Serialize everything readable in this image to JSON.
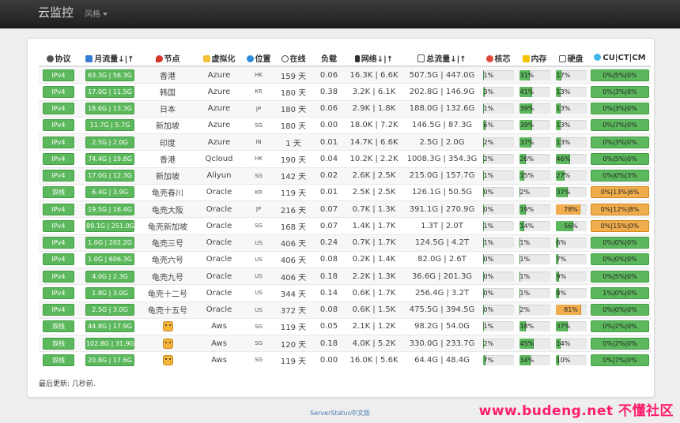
{
  "nav": {
    "brand": "云监控",
    "style_menu": "风格"
  },
  "headers": {
    "protocol": "协议",
    "monthly_traffic": "月流量↓|↑",
    "node": "节点",
    "virtualization": "虚拟化",
    "location": "位置",
    "uptime": "在线",
    "load": "负载",
    "network": "网络↓|↑",
    "total_traffic": "总流量↓|↑",
    "cpu": "核芯",
    "memory": "内存",
    "disk": "硬盘",
    "isp": "CU|CT|CM"
  },
  "rows": [
    {
      "proto": "IPv4",
      "traffic": "63.3G | 56.3G",
      "node": "香港",
      "virt": "Azure",
      "loc": "HK",
      "uptime": "159 天",
      "load": "0.06",
      "net": "16.3K | 6.6K",
      "total": "507.5G | 447.0G",
      "cpu": "1%",
      "cpu_v": 1,
      "mem": "31%",
      "mem_v": 31,
      "disk": "17%",
      "disk_v": 17,
      "isp": "0%|5%|0%",
      "isp_warn": false
    },
    {
      "proto": "IPv4",
      "traffic": "17.0G | 11.5G",
      "node": "韩国",
      "virt": "Azure",
      "loc": "KR",
      "uptime": "180 天",
      "load": "0.38",
      "net": "3.2K | 6.1K",
      "total": "202.8G | 146.9G",
      "cpu": "3%",
      "cpu_v": 3,
      "mem": "41%",
      "mem_v": 41,
      "disk": "13%",
      "disk_v": 13,
      "isp": "0%|3%|0%",
      "isp_warn": false
    },
    {
      "proto": "IPv4",
      "traffic": "18.6G | 13.3G",
      "node": "日本",
      "virt": "Azure",
      "loc": "JP",
      "uptime": "180 天",
      "load": "0.06",
      "net": "2.9K | 1.8K",
      "total": "188.0G | 132.6G",
      "cpu": "1%",
      "cpu_v": 1,
      "mem": "39%",
      "mem_v": 39,
      "disk": "13%",
      "disk_v": 13,
      "isp": "0%|3%|0%",
      "isp_warn": false
    },
    {
      "proto": "IPv4",
      "traffic": "11.7G | 5.7G",
      "node": "新加坡",
      "virt": "Azure",
      "loc": "SG",
      "uptime": "180 天",
      "load": "0.00",
      "net": "18.0K | 7.2K",
      "total": "146.5G | 87.3G",
      "cpu": "6%",
      "cpu_v": 6,
      "mem": "39%",
      "mem_v": 39,
      "disk": "13%",
      "disk_v": 13,
      "isp": "0%|7%|0%",
      "isp_warn": false
    },
    {
      "proto": "IPv4",
      "traffic": "2.5G | 2.0G",
      "node": "印度",
      "virt": "Azure",
      "loc": "IN",
      "uptime": "1 天",
      "load": "0.01",
      "net": "14.7K | 6.6K",
      "total": "2.5G | 2.0G",
      "cpu": "2%",
      "cpu_v": 2,
      "mem": "37%",
      "mem_v": 37,
      "disk": "13%",
      "disk_v": 13,
      "isp": "0%|3%|0%",
      "isp_warn": false
    },
    {
      "proto": "IPv4",
      "traffic": "74.4G | 19.8G",
      "node": "香港",
      "virt": "Qcloud",
      "loc": "HK",
      "uptime": "190 天",
      "load": "0.04",
      "net": "10.2K | 2.2K",
      "total": "1008.3G | 354.3G",
      "cpu": "2%",
      "cpu_v": 2,
      "mem": "20%",
      "mem_v": 20,
      "disk": "46%",
      "disk_v": 46,
      "isp": "0%|5%|0%",
      "isp_warn": false
    },
    {
      "proto": "IPv4",
      "traffic": "17.0G | 12.3G",
      "node": "新加坡",
      "virt": "Aliyun",
      "loc": "SG",
      "uptime": "142 天",
      "load": "0.02",
      "net": "2.6K | 2.5K",
      "total": "215.0G | 157.7G",
      "cpu": "1%",
      "cpu_v": 1,
      "mem": "15%",
      "mem_v": 15,
      "disk": "27%",
      "disk_v": 27,
      "isp": "0%|0%|3%",
      "isp_warn": false
    },
    {
      "proto": "双栈",
      "traffic": "6.4G | 3.9G",
      "node": "龟壳春川",
      "virt": "Oracle",
      "loc": "KR",
      "uptime": "119 天",
      "load": "0.01",
      "net": "2.5K | 2.5K",
      "total": "126.1G | 50.5G",
      "cpu": "0%",
      "cpu_v": 0,
      "mem": "2%",
      "mem_v": 2,
      "disk": "37%",
      "disk_v": 37,
      "isp": "0%|13%|6%",
      "isp_warn": true
    },
    {
      "proto": "IPv4",
      "traffic": "19.5G | 16.4G",
      "node": "龟壳大阪",
      "virt": "Oracle",
      "loc": "JP",
      "uptime": "216 天",
      "load": "0.07",
      "net": "0.7K | 1.3K",
      "total": "391.1G | 270.9G",
      "cpu": "0%",
      "cpu_v": 0,
      "mem": "19%",
      "mem_v": 19,
      "disk": "78%",
      "disk_v": 78,
      "isp": "0%|12%|8%",
      "isp_warn": true
    },
    {
      "proto": "IPv4",
      "traffic": "89.1G | 251.0G",
      "node": "龟壳新加坡",
      "virt": "Oracle",
      "loc": "SG",
      "uptime": "168 天",
      "load": "0.07",
      "net": "1.4K | 1.7K",
      "total": "1.3T | 2.0T",
      "cpu": "1%",
      "cpu_v": 1,
      "mem": "14%",
      "mem_v": 14,
      "disk": "56%",
      "disk_v": 56,
      "isp": "0%|15%|0%",
      "isp_warn": true
    },
    {
      "proto": "IPv4",
      "traffic": "1.0G | 202.2G",
      "node": "龟壳三号",
      "virt": "Oracle",
      "loc": "US",
      "uptime": "406 天",
      "load": "0.24",
      "net": "0.7K | 1.7K",
      "total": "124.5G | 4.2T",
      "cpu": "1%",
      "cpu_v": 1,
      "mem": "1%",
      "mem_v": 1,
      "disk": "6%",
      "disk_v": 6,
      "isp": "0%|0%|0%",
      "isp_warn": false
    },
    {
      "proto": "IPv4",
      "traffic": "1.0G | 606.3G",
      "node": "龟壳六号",
      "virt": "Oracle",
      "loc": "US",
      "uptime": "406 天",
      "load": "0.08",
      "net": "0.2K | 1.4K",
      "total": "82.0G | 2.6T",
      "cpu": "0%",
      "cpu_v": 0,
      "mem": "1%",
      "mem_v": 1,
      "disk": "7%",
      "disk_v": 7,
      "isp": "0%|0%|0%",
      "isp_warn": false
    },
    {
      "proto": "IPv4",
      "traffic": "4.0G | 2.3G",
      "node": "龟壳九号",
      "virt": "Oracle",
      "loc": "US",
      "uptime": "406 天",
      "load": "0.18",
      "net": "2.2K | 1.3K",
      "total": "36.6G | 201.3G",
      "cpu": "0%",
      "cpu_v": 0,
      "mem": "1%",
      "mem_v": 1,
      "disk": "9%",
      "disk_v": 9,
      "isp": "0%|5%|0%",
      "isp_warn": false
    },
    {
      "proto": "IPv4",
      "traffic": "1.8G | 3.0G",
      "node": "龟壳十二号",
      "virt": "Oracle",
      "loc": "US",
      "uptime": "344 天",
      "load": "0.14",
      "net": "0.6K | 1.7K",
      "total": "256.4G | 3.2T",
      "cpu": "0%",
      "cpu_v": 0,
      "mem": "1%",
      "mem_v": 1,
      "disk": "8%",
      "disk_v": 8,
      "isp": "1%|0%|0%",
      "isp_warn": false
    },
    {
      "proto": "IPv4",
      "traffic": "2.5G | 3.0G",
      "node": "龟壳十五号",
      "virt": "Oracle",
      "loc": "US",
      "uptime": "372 天",
      "load": "0.08",
      "net": "0.6K | 1.5K",
      "total": "475.5G | 394.5G",
      "cpu": "0%",
      "cpu_v": 0,
      "mem": "2%",
      "mem_v": 2,
      "disk": "81%",
      "disk_v": 81,
      "isp": "0%|0%|0%",
      "isp_warn": false
    },
    {
      "proto": "双栈",
      "traffic": "44.8G | 17.9G",
      "node": "",
      "virt": "Aws",
      "loc": "SG",
      "uptime": "119 天",
      "load": "0.05",
      "net": "2.1K | 1.2K",
      "total": "98.2G | 54.0G",
      "cpu": "1%",
      "cpu_v": 1,
      "mem": "18%",
      "mem_v": 18,
      "disk": "37%",
      "disk_v": 37,
      "isp": "0%|2%|0%",
      "isp_warn": false
    },
    {
      "proto": "双栈",
      "traffic": "102.8G | 31.9G",
      "node": "",
      "virt": "Aws",
      "loc": "SG",
      "uptime": "120 天",
      "load": "0.18",
      "net": "4.0K | 5.2K",
      "total": "330.0G | 233.7G",
      "cpu": "2%",
      "cpu_v": 2,
      "mem": "45%",
      "mem_v": 45,
      "disk": "14%",
      "disk_v": 14,
      "isp": "0%|2%|0%",
      "isp_warn": false
    },
    {
      "proto": "双栈",
      "traffic": "20.8G | 17.6G",
      "node": "",
      "virt": "Aws",
      "loc": "SG",
      "uptime": "119 天",
      "load": "0.00",
      "net": "16.0K | 5.6K",
      "total": "64.4G | 48.4G",
      "cpu": "7%",
      "cpu_v": 7,
      "mem": "34%",
      "mem_v": 34,
      "disk": "10%",
      "disk_v": 10,
      "isp": "0%|7%|0%",
      "isp_warn": false
    }
  ],
  "updated": "最后更新: 几秒前.",
  "footer": "ServerStatus中文版",
  "watermark": "www.budeng.net 不懂社区",
  "colors": {
    "ok": "#5cb85c",
    "warn": "#f0ad4e",
    "navbar": "#2b2b2b",
    "link": "#4a7bb5"
  }
}
